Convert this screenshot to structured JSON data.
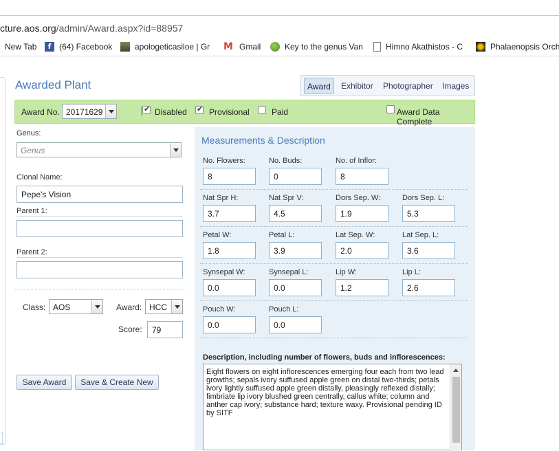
{
  "browser": {
    "address": "cture.aos.org/admin/Award.aspx?id=88957",
    "address_host": "cture.aos.org",
    "address_path": "/admin/Award.aspx?id=88957",
    "bookmarks": [
      {
        "label": "New Tab",
        "icon": "none"
      },
      {
        "label": "(64) Facebook",
        "icon": "facebook-icon"
      },
      {
        "label": "apologeticasiloe | Gr",
        "icon": "site-thumbnail-icon"
      },
      {
        "label": "Gmail",
        "icon": "gmail-icon"
      },
      {
        "label": "Key to the genus Van",
        "icon": "leaf-icon"
      },
      {
        "label": "Himno Akathistos - C",
        "icon": "page-icon"
      },
      {
        "label": "Phalaenopsis Orch",
        "icon": "flower-icon"
      }
    ]
  },
  "page": {
    "title": "Awarded Plant",
    "tabs": [
      "Award",
      "Exhibitor",
      "Photographer",
      "Images"
    ],
    "active_tab": "Award"
  },
  "award_bar": {
    "award_no_label": "Award No.",
    "award_no_value": "20171629",
    "disabled_label": "Disabled",
    "disabled_checked": true,
    "provisional_label": "Provisional",
    "provisional_checked": true,
    "paid_label": "Paid",
    "paid_checked": false,
    "complete_label": "Award Data Complete",
    "complete_checked": false
  },
  "left_form": {
    "genus_label": "Genus:",
    "genus_placeholder": "Genus",
    "clonal_label": "Clonal Name:",
    "clonal_value": "Pepe's Vision",
    "parent1_label": "Parent 1:",
    "parent1_value": "",
    "parent2_label": "Parent 2:",
    "parent2_value": "",
    "class_label": "Class:",
    "class_value": "AOS",
    "award_label": "Award:",
    "award_value": "HCC",
    "score_label": "Score:",
    "score_value": "79",
    "save_award": "Save Award",
    "save_create_new": "Save & Create New"
  },
  "measurements": {
    "title": "Measurements & Description",
    "rows": [
      [
        {
          "label": "No. Flowers:",
          "value": "8"
        },
        {
          "label": "No. Buds:",
          "value": "0"
        },
        {
          "label": "No. of Inflor:",
          "value": "8"
        }
      ],
      [
        {
          "label": "Nat Spr H:",
          "value": "3.7"
        },
        {
          "label": "Nat Spr V:",
          "value": "4.5"
        },
        {
          "label": "Dors Sep. W:",
          "value": "1.9"
        },
        {
          "label": "Dors Sep. L:",
          "value": "5.3"
        }
      ],
      [
        {
          "label": "Petal W:",
          "value": "1.8"
        },
        {
          "label": "Petal L:",
          "value": "3.9"
        },
        {
          "label": "Lat Sep. W:",
          "value": "2.0"
        },
        {
          "label": "Lat Sep. L:",
          "value": "3.6"
        }
      ],
      [
        {
          "label": "Synsepal W:",
          "value": "0.0"
        },
        {
          "label": "Synsepal L:",
          "value": "0.0"
        },
        {
          "label": "Lip W:",
          "value": "1.2"
        },
        {
          "label": "Lip L:",
          "value": "2.6"
        }
      ],
      [
        {
          "label": "Pouch W:",
          "value": "0.0"
        },
        {
          "label": "Pouch L:",
          "value": "0.0"
        }
      ]
    ],
    "description_label": "Description, including number of flowers, buds and inflorescences:",
    "description": "Eight flowers on eight inflorescences emerging four each from two lead growths; sepals ivory suffused apple green on distal two-thirds; petals ivory lightly suffused apple green distally, pleasingly reflexed distally; fimbriate lip ivory blushed green centrally, callus white; column and anther cap ivory; substance hard; texture waxy. Provisional pending ID by SITF"
  }
}
